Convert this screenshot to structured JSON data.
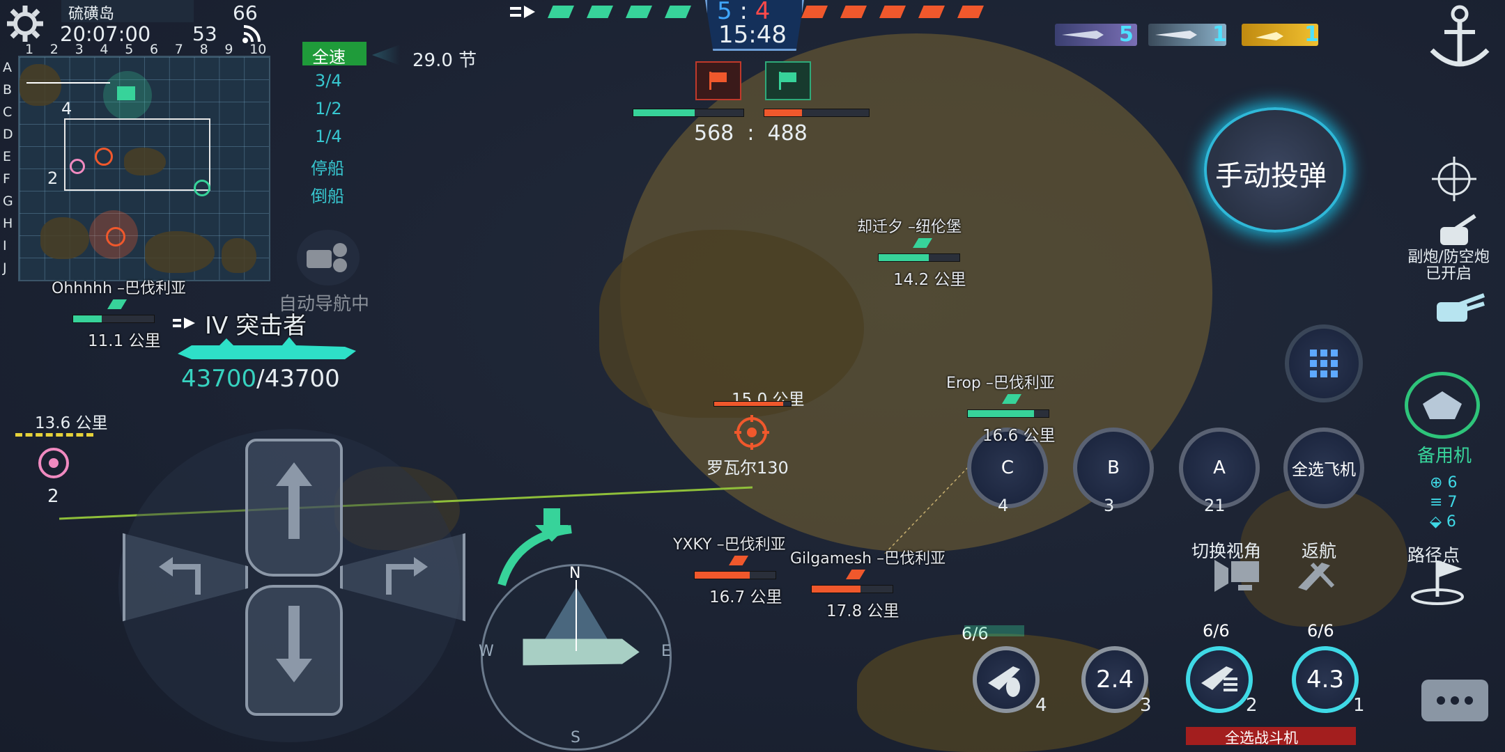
{
  "top_left": {
    "map_name": "硫磺岛",
    "time": "20:07:00",
    "fps": "66",
    "ping": "53"
  },
  "minimap": {
    "cols": [
      "1",
      "2",
      "3",
      "4",
      "5",
      "6",
      "7",
      "8",
      "9",
      "10"
    ],
    "rows": [
      "A",
      "B",
      "C",
      "D",
      "E",
      "F",
      "G",
      "H",
      "I",
      "J"
    ],
    "marker_4": "4",
    "marker_2": "2"
  },
  "speed": {
    "options": [
      "全速",
      "3/4",
      "1/2",
      "1/4",
      "停船",
      "倒船"
    ],
    "current_speed": "29.0 节"
  },
  "autopilot_label": "自动导航中",
  "player": {
    "class_label": "IV 突击者",
    "hp_current": "43700",
    "hp_max": "/43700"
  },
  "score": {
    "ally_kills": "5",
    "separator": ":",
    "enemy_kills": "4",
    "timer": "15:48",
    "ally_points": "568",
    "points_sep": ":",
    "enemy_points": "488"
  },
  "air_counts": {
    "bombers": "5",
    "fighters": "1",
    "torpedo": "1"
  },
  "ships": [
    {
      "name": "却迁夕 –纽伦堡",
      "dist": "14.2 公里",
      "side": "ally",
      "hp": 0.62
    },
    {
      "name": "Ohhhhh –巴伐利亚",
      "dist": "11.1 公里",
      "side": "ally",
      "hp": 0.35
    },
    {
      "name": "Erop –巴伐利亚",
      "dist": "16.6 公里",
      "side": "ally",
      "hp": 0.82
    },
    {
      "name": "YXKY –巴伐利亚",
      "dist": "16.7 公里",
      "side": "enemy",
      "hp": 0.68
    },
    {
      "name": "Gilgamesh –巴伐利亚",
      "dist": "17.8 公里",
      "side": "enemy",
      "hp": 0.6
    }
  ],
  "target": {
    "dist": "15.0 公里",
    "name": "罗瓦尔130",
    "hp": 0.9
  },
  "left_marker": {
    "dist": "13.6 公里",
    "num": "2"
  },
  "compass": {
    "n": "N",
    "s": "S",
    "e": "E",
    "w": "W"
  },
  "right_panel": {
    "manual_bomb": "手动投弹",
    "secondary_label": "副炮/防空炮\n已开启",
    "reserve_label": "备用机",
    "reserve_counts": [
      "6",
      "7",
      "6"
    ],
    "waypoint_label": "路径点",
    "switch_view_label": "切换视角",
    "return_label": "返航",
    "select_all_planes": "全选飞机",
    "select_all_fighters": "全选战斗机"
  },
  "squadrons": [
    {
      "label": "C",
      "count": "4"
    },
    {
      "label": "B",
      "count": "3"
    },
    {
      "label": "A",
      "count": "21"
    }
  ],
  "plane_slots": [
    {
      "status": "6/6",
      "count": "4",
      "timer": ""
    },
    {
      "status": "",
      "count": "3",
      "timer": "2.4"
    },
    {
      "status": "6/6",
      "count": "2",
      "timer": ""
    },
    {
      "status": "6/6",
      "count": "1",
      "timer": "4.3"
    }
  ],
  "colors": {
    "ally": "#37d39a",
    "enemy": "#f0582c",
    "accent": "#39c6d6"
  }
}
